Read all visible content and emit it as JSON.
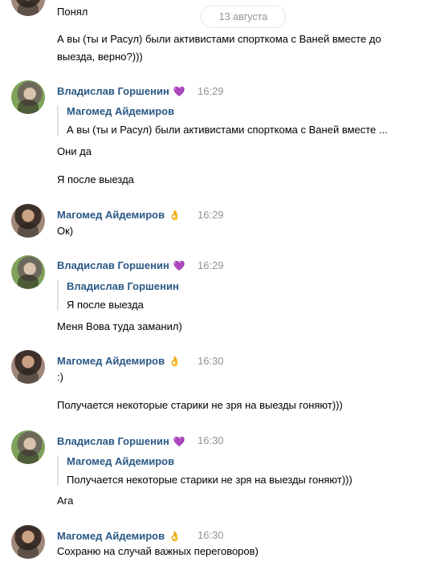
{
  "date_separator": "13 августа",
  "badges": {
    "vlad": "💜",
    "magomed": "👌"
  },
  "top": {
    "line1": "Понял",
    "line2": "А вы (ты и Расул) были активистами спорткома с Ваней вместе до",
    "line3": "выезда, верно?)))"
  },
  "messages": [
    {
      "author": "Владислав Горшенин",
      "time": "16:29",
      "quote_author": "Магомед Айдемиров",
      "quote_text": "А вы (ты и Расул) были активистами спорткома с Ваней вместе ...",
      "lines": [
        "Они да",
        "Я после выезда"
      ]
    },
    {
      "author": "Магомед Айдемиров",
      "time": "16:29",
      "lines": [
        "Ок)"
      ]
    },
    {
      "author": "Владислав Горшенин",
      "time": "16:29",
      "quote_author": "Владислав Горшенин",
      "quote_text": "Я после выезда",
      "lines": [
        "Меня Вова туда заманил)"
      ]
    },
    {
      "author": "Магомед Айдемиров",
      "time": "16:30",
      "lines": [
        ":)",
        "Получается некоторые старики не зря на выезды гоняют)))"
      ]
    },
    {
      "author": "Владислав Горшенин",
      "time": "16:30",
      "quote_author": "Магомед Айдемиров",
      "quote_text": "Получается некоторые старики не зря на выезды гоняют)))",
      "lines": [
        "Ага"
      ]
    },
    {
      "author": "Магомед Айдемиров",
      "time": "16:30",
      "lines": [
        "Сохраню на случай важных переговоров)"
      ]
    }
  ]
}
